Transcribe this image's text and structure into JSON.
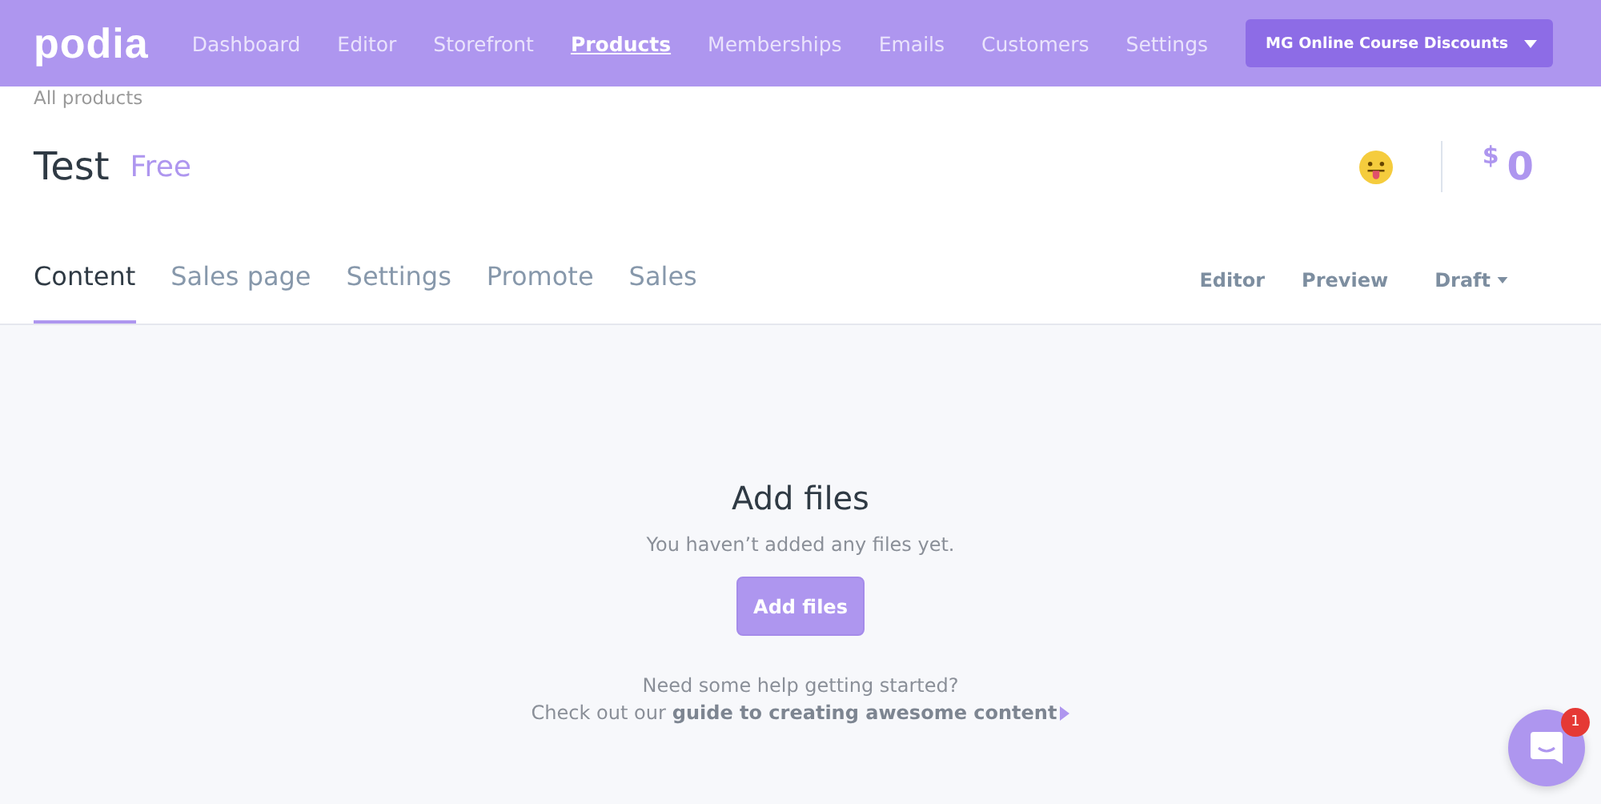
{
  "header": {
    "logo": "podia",
    "nav": [
      {
        "label": "Dashboard",
        "selected": false
      },
      {
        "label": "Editor",
        "selected": false
      },
      {
        "label": "Storefront",
        "selected": false
      },
      {
        "label": "Products",
        "selected": true
      },
      {
        "label": "Memberships",
        "selected": false
      },
      {
        "label": "Emails",
        "selected": false
      },
      {
        "label": "Customers",
        "selected": false
      },
      {
        "label": "Settings",
        "selected": false
      }
    ],
    "account_button": "MG Online Course Discounts"
  },
  "breadcrumb": "All products",
  "product": {
    "title": "Test",
    "price_label": "Free",
    "currency": "$",
    "revenue": "0"
  },
  "tabs": [
    {
      "label": "Content",
      "selected": true
    },
    {
      "label": "Sales page",
      "selected": false
    },
    {
      "label": "Settings",
      "selected": false
    },
    {
      "label": "Promote",
      "selected": false
    },
    {
      "label": "Sales",
      "selected": false
    }
  ],
  "actions": {
    "editor": "Editor",
    "preview": "Preview",
    "status": "Draft"
  },
  "empty_state": {
    "heading": "Add files",
    "message": "You haven’t added any files yet.",
    "button": "Add files",
    "help_line": "Need some help getting started?",
    "help_prefix": "Check out our",
    "help_link": "guide to creating awesome content"
  },
  "chat": {
    "badge": "1"
  }
}
